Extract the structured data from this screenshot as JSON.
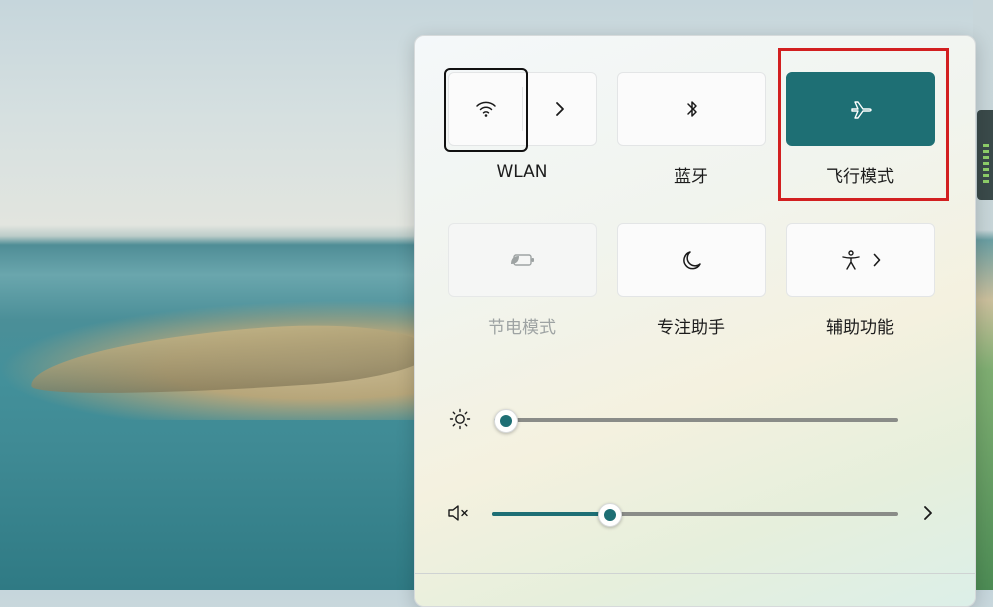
{
  "quick_settings": {
    "tiles": [
      {
        "id": "wlan",
        "label": "WLAN",
        "icon": "wifi-icon",
        "state": "off"
      },
      {
        "id": "bluetooth",
        "label": "蓝牙",
        "icon": "bluetooth-icon",
        "state": "off"
      },
      {
        "id": "airplane",
        "label": "飞行模式",
        "icon": "airplane-icon",
        "state": "on"
      },
      {
        "id": "battery_saver",
        "label": "节电模式",
        "icon": "battery-saver-icon",
        "state": "disabled"
      },
      {
        "id": "focus_assist",
        "label": "专注助手",
        "icon": "moon-icon",
        "state": "off"
      },
      {
        "id": "accessibility",
        "label": "辅助功能",
        "icon": "accessibility-icon",
        "state": "off"
      }
    ],
    "brightness": {
      "icon": "sun-icon",
      "level": 0.03
    },
    "volume": {
      "icon": "volume-muted-icon",
      "level": 0.29
    }
  },
  "colors": {
    "accent": "#1e6f74",
    "highlight_box": "#d21f20"
  }
}
